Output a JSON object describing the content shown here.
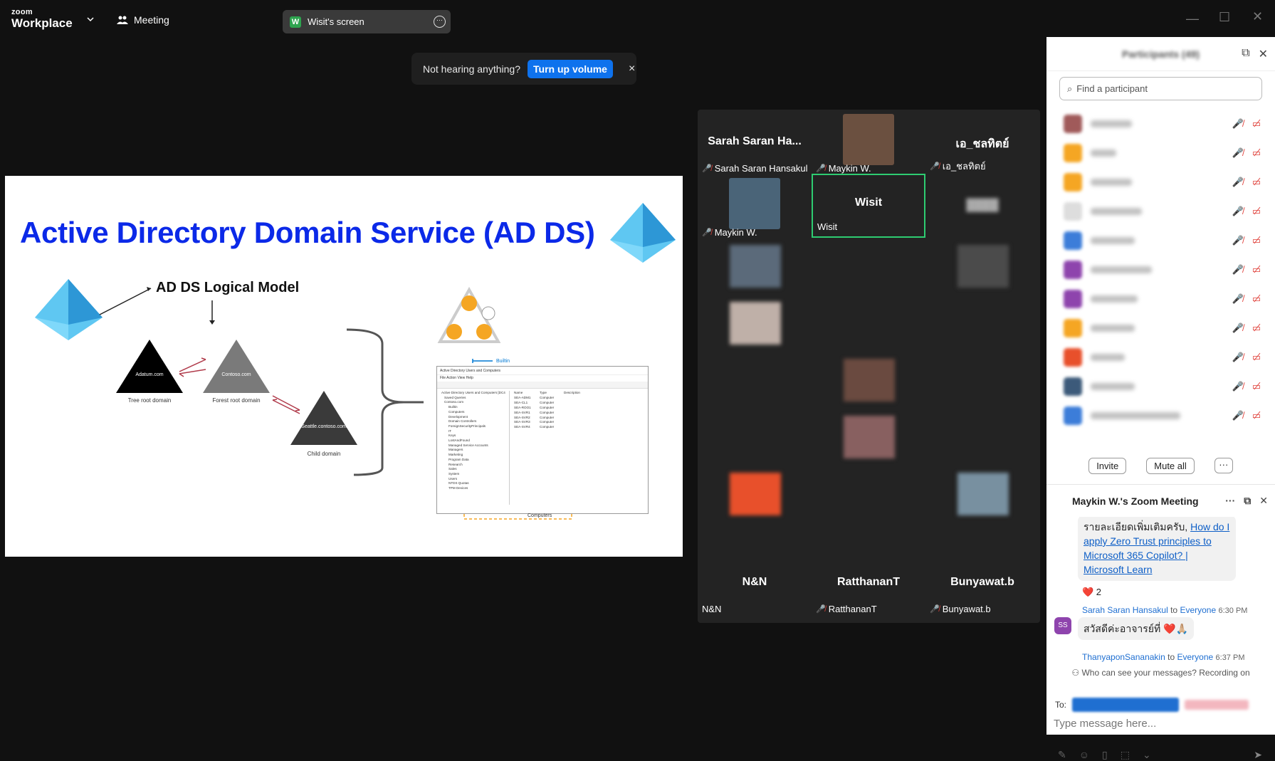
{
  "app": {
    "brand_small": "zoom",
    "brand_big": "Workplace",
    "meeting_label": "Meeting",
    "screen_pill_letter": "W",
    "screen_pill_label": "Wisit's screen"
  },
  "toast": {
    "message": "Not hearing anything?",
    "button": "Turn up volume",
    "close": "×"
  },
  "slide": {
    "title": "Active Directory Domain Service (AD DS)",
    "subtitle": "AD DS Logical Model",
    "tri_adatum": "Adatum.com",
    "tri_contoso": "Contoso.com",
    "tri_seattle": "Seattle.contoso.com",
    "cap_tree": "Tree root domain",
    "cap_forest": "Forest root domain",
    "cap_child": "Child domain",
    "builtin": "Builtin",
    "computers": "Computers",
    "aduc_title": "Active Directory Users and Computers",
    "aduc_menu": "File   Action   View   Help",
    "aduc_tree": [
      "Active Directory Users and Computers [DC4",
      "Saved Queries",
      "Contoso.com",
      "Builtin",
      "Computers",
      "Development",
      "Domain Controllers",
      "ForeignSecurityPrincipals",
      "IT",
      "Keys",
      "LostAndFound",
      "Managed Service Accounts",
      "Managers",
      "Marketing",
      "Program Data",
      "Research",
      "Sales",
      "System",
      "Users",
      "NTDS Quotas",
      "TPM Devices"
    ],
    "aduc_cols": [
      "Name",
      "Type",
      "Description"
    ],
    "aduc_rows": [
      [
        "SEA-ADM1",
        "Computer"
      ],
      [
        "SEA-CL1",
        "Computer"
      ],
      [
        "SEA-ROO1",
        "Computer"
      ],
      [
        "SEA-SVR1",
        "Computer"
      ],
      [
        "SEA-SVR2",
        "Computer"
      ],
      [
        "SEA-SVR3",
        "Computer"
      ],
      [
        "SEA-SVR4",
        "Computer"
      ]
    ]
  },
  "gallery": {
    "tiles": [
      {
        "center": "Sarah Saran Ha...",
        "label": "Sarah Saran Hansakul",
        "muted": true
      },
      {
        "center": "",
        "label": "Maykin W.",
        "muted": true,
        "photo": true
      },
      {
        "center": "เอ_ชลทิตย์",
        "label": "เอ_ชลทิตย์",
        "muted": true
      },
      {
        "center": "",
        "label": "Maykin W.",
        "muted": true,
        "photo": true
      },
      {
        "center": "Wisit",
        "label": "Wisit",
        "muted": false,
        "active": true
      },
      {
        "center": "",
        "label": "",
        "muted": true
      },
      {
        "center": "N&N",
        "label": "N&N",
        "muted": false
      },
      {
        "center": "RatthananT",
        "label": "RatthananT",
        "muted": true
      },
      {
        "center": "Bunyawat.b",
        "label": "Bunyawat.b",
        "muted": true
      }
    ]
  },
  "panel": {
    "participants_title": "Participants (49)",
    "search_placeholder": "Find a participant",
    "invite": "Invite",
    "mute_all": "Mute all",
    "more": "···",
    "avatar_colors": [
      "#a05a5a",
      "#f5a623",
      "#f5a623",
      "#dddddd",
      "#3c7dd9",
      "#8e44ad",
      "#8e44ad",
      "#f5a623",
      "#e8502b",
      "#3c5a7a",
      "#3c7dd9"
    ]
  },
  "chat": {
    "title": "Maykin W.'s Zoom Meeting",
    "msg1_prefix": "รายละเอียดเพิ่มเติมครับ, ",
    "msg1_link": "How do I apply Zero Trust principles to Microsoft 365 Copilot? | Microsoft Learn",
    "reaction": "❤️ 2",
    "sender2": "Sarah Saran Hansakul",
    "to_word": "to",
    "everyone": "Everyone",
    "time2": "6:30 PM",
    "avatar2": "SS",
    "msg2": "สวัสดีค่ะอาจารย์ที่ ❤️🙏🏼",
    "sender3": "ThanyaponSananakin",
    "time3": "6:37 PM",
    "notice": "Who can see your messages? Recording on",
    "to_label": "To:",
    "input_placeholder": "Type message here..."
  }
}
